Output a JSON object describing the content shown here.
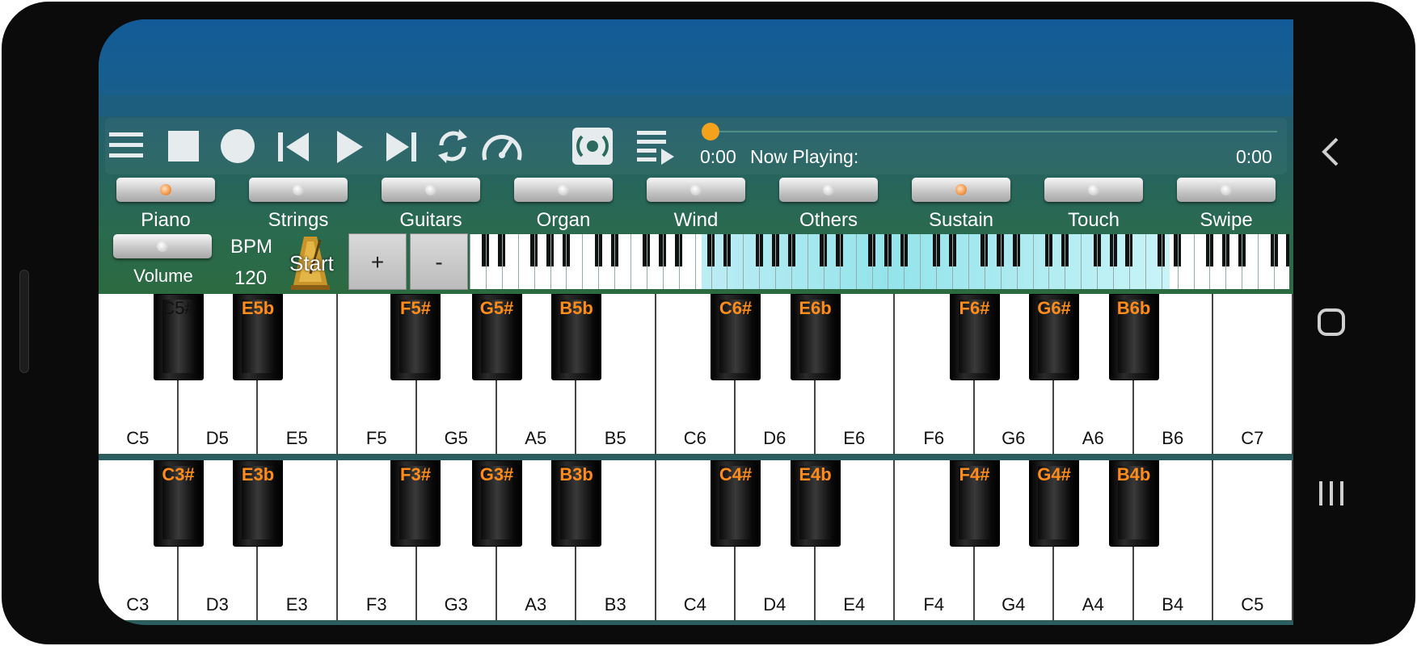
{
  "transport": {
    "time_current": "0:00",
    "now_playing": "Now Playing:",
    "time_total": "0:00",
    "progress": 0,
    "seek_color": "#f4a11c"
  },
  "instruments": [
    {
      "label": "Piano",
      "on": true
    },
    {
      "label": "Strings",
      "on": false
    },
    {
      "label": "Guitars",
      "on": false
    },
    {
      "label": "Organ",
      "on": false
    },
    {
      "label": "Wind",
      "on": false
    },
    {
      "label": "Others",
      "on": false
    },
    {
      "label": "Sustain",
      "on": true
    },
    {
      "label": "Touch",
      "on": false
    },
    {
      "label": "Swipe",
      "on": false
    }
  ],
  "controls": {
    "volume_label": "Volume",
    "bpm_label": "BPM",
    "bpm_value": "120",
    "start_label": "Start",
    "plus_label": "+",
    "minus_label": "-"
  },
  "keyboard_top": {
    "white": [
      "C5",
      "D5",
      "E5",
      "F5",
      "G5",
      "A5",
      "B5",
      "C6",
      "D6",
      "E6",
      "F6",
      "G6",
      "A6",
      "B6",
      "C7"
    ],
    "black": [
      "C5#",
      "E5b",
      "F5#",
      "G5#",
      "B5b",
      "C6#",
      "E6b",
      "F6#",
      "G6#",
      "B6b"
    ]
  },
  "keyboard_bottom": {
    "white": [
      "C3",
      "D3",
      "E3",
      "F3",
      "G3",
      "A3",
      "B3",
      "C4",
      "D4",
      "E4",
      "F4",
      "G4",
      "A4",
      "B4",
      "C5"
    ],
    "black": [
      "C3#",
      "E3b",
      "F3#",
      "G3#",
      "B3b",
      "C4#",
      "E4b",
      "F4#",
      "G4#",
      "B4b"
    ]
  },
  "colors": {
    "accent": "#f4a11c",
    "black_key_label": "#ff8c1a",
    "status_bar": "#135b98",
    "toolbar": "#2a6a4e"
  }
}
